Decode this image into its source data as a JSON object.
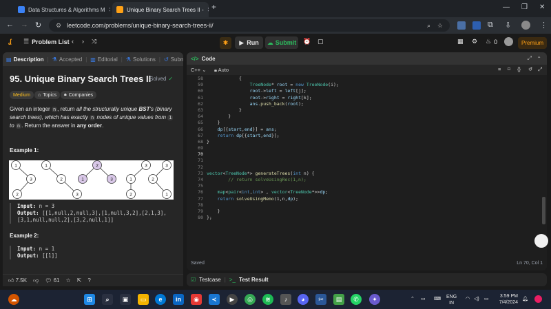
{
  "browser": {
    "tabs": [
      {
        "title": "Data Structures & Algorithms M",
        "active": false
      },
      {
        "title": "Unique Binary Search Trees II - ",
        "active": true
      }
    ],
    "url": "leetcode.com/problems/unique-binary-search-trees-ii/"
  },
  "lc_nav": {
    "problem_list": "Problem List",
    "run": "Run",
    "submit": "Submit",
    "fire_count": "0",
    "premium": "Premium"
  },
  "left_tabs": [
    "Description",
    "Accepted",
    "Editorial",
    "Solutions",
    "Submi"
  ],
  "problem": {
    "title": "95. Unique Binary Search Trees II",
    "status": "Solved",
    "difficulty": "Medium",
    "topics": "Topics",
    "companies": "Companies",
    "desc_1": "Given an integer ",
    "desc_n": "n",
    "desc_2": ", return ",
    "desc_3": "all the structurally unique ",
    "desc_bst": "BST",
    "desc_4": "'s (binary search trees), which has exactly ",
    "desc_5": " nodes of unique values from ",
    "desc_one": "1",
    "desc_to": " to ",
    "desc_6": ". Return the answer in ",
    "desc_order": "any order",
    "desc_end": "."
  },
  "example1": {
    "heading": "Example 1:",
    "input_label": "Input:",
    "input_value": " n = 3",
    "output_label": "Output:",
    "output_value": " [[1,null,2,null,3],[1,null,3,2],[2,1,3],",
    "output_value_2": "[3,1,null,null,2],[3,2,null,1]]"
  },
  "example2": {
    "heading": "Example 2:",
    "input_label": "Input:",
    "input_value": " n = 1",
    "output_label": "Output:",
    "output_value": " [[1]]"
  },
  "footer": {
    "likes": "7.5K",
    "comments": "61"
  },
  "editor": {
    "title": "Code",
    "language": "C++",
    "mode": "Auto",
    "status": "Saved",
    "cursor": "Ln 70, Col 1",
    "lines": [
      {
        "n": "58",
        "code": "            {"
      },
      {
        "n": "59",
        "code": "                TreeNode* root = new TreeNode(i);"
      },
      {
        "n": "60",
        "code": "                root->left = left[j];"
      },
      {
        "n": "61",
        "code": "                root->right = right[k];"
      },
      {
        "n": "62",
        "code": "                ans.push_back(root);"
      },
      {
        "n": "63",
        "code": "            }"
      },
      {
        "n": "64",
        "code": "        }"
      },
      {
        "n": "65",
        "code": "    }"
      },
      {
        "n": "66",
        "code": "    dp[{start,end}] = ans;"
      },
      {
        "n": "67",
        "code": "    return dp[{start,end}];"
      },
      {
        "n": "68",
        "code": "}"
      },
      {
        "n": "69",
        "code": ""
      },
      {
        "n": "70",
        "code": ""
      },
      {
        "n": "71",
        "code": ""
      },
      {
        "n": "72",
        "code": ""
      },
      {
        "n": "73",
        "code": "vector<TreeNode*> generateTrees(int n) {"
      },
      {
        "n": "74",
        "code": "        // return solveUsingRec(1,n);"
      },
      {
        "n": "75",
        "code": ""
      },
      {
        "n": "76",
        "code": "    map<pair<int,int> , vector<TreeNode*>>dp;"
      },
      {
        "n": "77",
        "code": "    return solveUsingMemo(1,n,dp);"
      },
      {
        "n": "78",
        "code": ""
      },
      {
        "n": "79",
        "code": "    }"
      },
      {
        "n": "80",
        "code": "};"
      }
    ]
  },
  "testcase": {
    "tab1": "Testcase",
    "tab2": "Test Result"
  },
  "taskbar": {
    "lang_1": "ENG",
    "lang_2": "IN",
    "time": "3:59 PM",
    "date": "7/4/2024"
  },
  "tree_nodes": [
    "1",
    "3",
    "2",
    "1",
    "2",
    "3",
    "2",
    "1",
    "3",
    "3",
    "1",
    "2",
    "3",
    "2",
    "1"
  ]
}
